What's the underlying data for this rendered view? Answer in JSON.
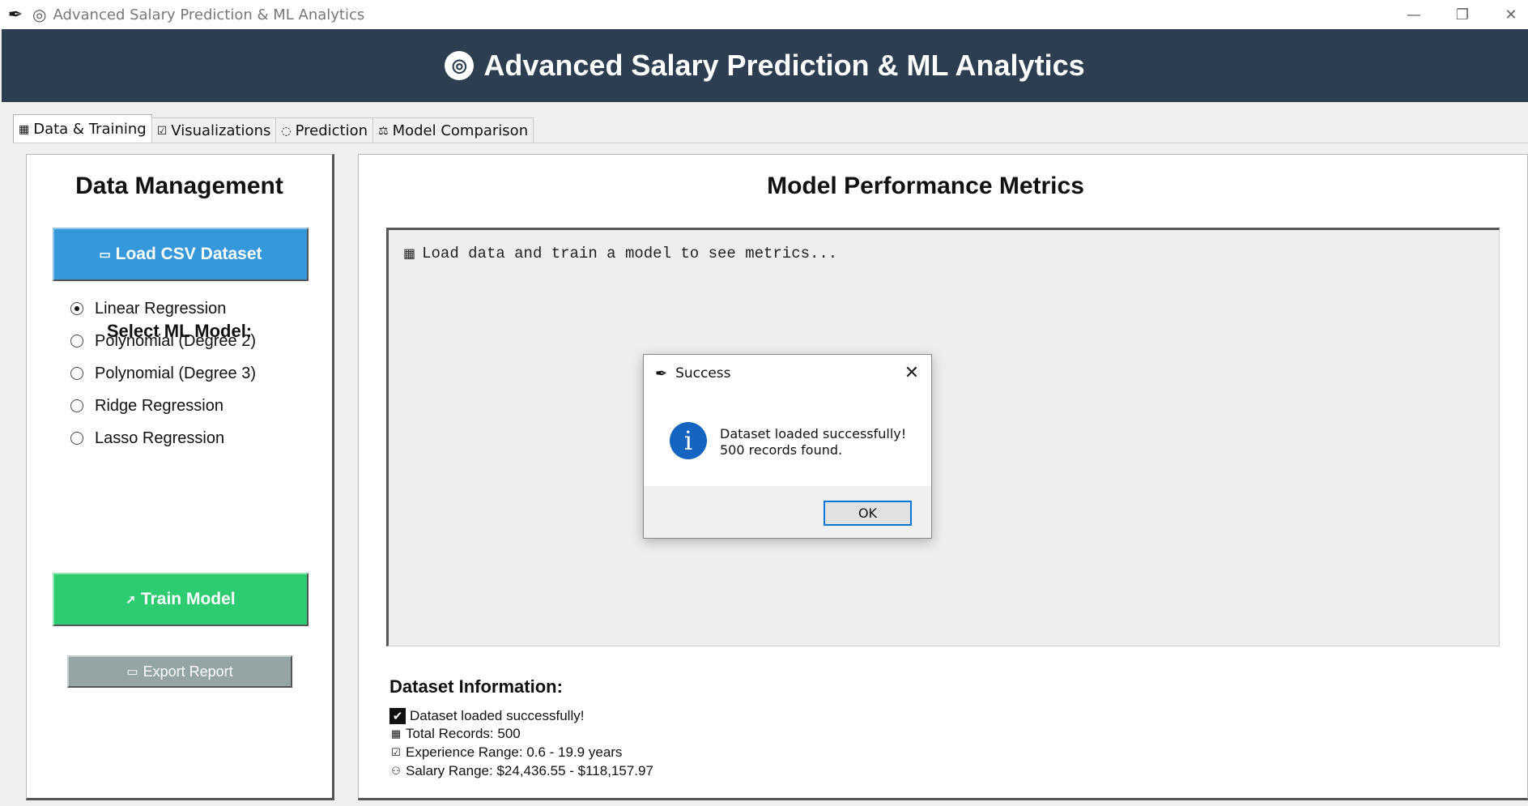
{
  "window": {
    "title": "Advanced Salary Prediction & ML Analytics",
    "app_icon": "feather-icon",
    "minimize_glyph": "—",
    "maximize_glyph": "❐",
    "close_glyph": "✕"
  },
  "header": {
    "icon": "target-icon",
    "icon_glyph": "◎",
    "title": "Advanced Salary Prediction & ML Analytics",
    "background": "#2c3e50"
  },
  "tabs": [
    {
      "label": "Data & Training",
      "icon": "bar-chart-icon",
      "glyph": "▦",
      "active": true
    },
    {
      "label": "Visualizations",
      "icon": "checkbox-icon",
      "glyph": "☑",
      "active": false
    },
    {
      "label": "Prediction",
      "icon": "crystal-ball-icon",
      "glyph": "◌",
      "active": false
    },
    {
      "label": "Model Comparison",
      "icon": "scales-icon",
      "glyph": "⚖",
      "active": false
    }
  ],
  "data_panel": {
    "title": "Data Management",
    "load_button": {
      "label": "Load CSV Dataset",
      "icon": "folder-icon",
      "glyph": "▭",
      "color": "#3498db"
    },
    "model_select_title": "Select ML Model:",
    "models": [
      {
        "label": "Linear Regression",
        "selected": true
      },
      {
        "label": "Polynomial (Degree 2)",
        "selected": false
      },
      {
        "label": "Polynomial (Degree 3)",
        "selected": false
      },
      {
        "label": "Ridge Regression",
        "selected": false
      },
      {
        "label": "Lasso Regression",
        "selected": false
      }
    ],
    "train_button": {
      "label": "Train Model",
      "icon": "rocket-icon",
      "glyph": "➚",
      "color": "#2ecc71"
    },
    "export_button": {
      "label": "Export Report",
      "icon": "document-icon",
      "glyph": "▭",
      "color": "#95a5a6"
    }
  },
  "metrics_panel": {
    "title": "Model Performance Metrics",
    "placeholder": "Load data and train a model to see metrics...",
    "placeholder_icon": "bar-chart-icon",
    "placeholder_glyph": "▦"
  },
  "dataset_info": {
    "title": "Dataset Information:",
    "lines": [
      {
        "text": "Dataset loaded successfully!",
        "icon": "check-icon",
        "glyph": "✔"
      },
      {
        "text": "Total Records: 500",
        "icon": "bar-chart-icon",
        "glyph": "▦"
      },
      {
        "text": "Experience Range: 0.6 - 19.9 years",
        "icon": "checkbox-icon",
        "glyph": "☑"
      },
      {
        "text": "Salary Range: $24,436.55 - $118,157.97",
        "icon": "money-bag-icon",
        "glyph": "⚇"
      }
    ]
  },
  "dialog": {
    "title": "Success",
    "icon": "info-icon",
    "icon_glyph": "i",
    "message_line1": "Dataset loaded successfully!",
    "message_line2": "500 records found.",
    "ok_label": "OK",
    "close_glyph": "✕"
  }
}
